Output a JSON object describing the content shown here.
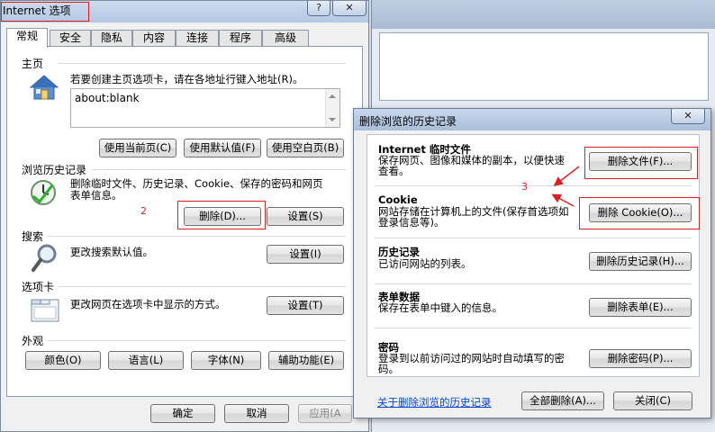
{
  "internet_options": {
    "title": "Internet 选项",
    "tabs": [
      "常规",
      "安全",
      "隐私",
      "内容",
      "连接",
      "程序",
      "高级"
    ],
    "home_page": {
      "section": "主页",
      "description": "若要创建主页选项卡，请在各地址行键入地址(R)。",
      "url_value": "about:blank",
      "use_current_button": "使用当前页(C)",
      "use_default_button": "使用默认值(F)",
      "use_blank_button": "使用空白页(B)"
    },
    "browsing_history": {
      "section": "浏览历史记录",
      "description_line1": "删除临时文件、历史记录、Cookie、保存的密码和网页",
      "description_line2": "表单信息。",
      "delete_button": "删除(D)...",
      "settings_button": "设置(S)"
    },
    "search": {
      "section": "搜索",
      "description": "更改搜索默认值。",
      "settings_button": "设置(I)"
    },
    "tabs_section": {
      "section": "选项卡",
      "description": "更改网页在选项卡中显示的方式。",
      "settings_button": "设置(T)"
    },
    "appearance": {
      "section": "外观",
      "colors_button": "颜色(O)",
      "languages_button": "语言(L)",
      "fonts_button": "字体(N)",
      "accessibility_button": "辅助功能(E)"
    },
    "footer": {
      "ok_button": "确定",
      "cancel_button": "取消",
      "apply_button": "应用(A"
    },
    "titlebar_help": "?",
    "titlebar_close": "✕"
  },
  "delete_history": {
    "title": "删除浏览的历史记录",
    "titlebar_close": "✕",
    "temp_files": {
      "title": "Internet 临时文件",
      "desc_line1": "保存网页、图像和媒体的副本，以便快速",
      "desc_line2": "查看。",
      "button": "删除文件(F)..."
    },
    "cookie": {
      "title": "Cookie",
      "desc_line1": "网站存储在计算机上的文件(保存首选项如",
      "desc_line2": "登录信息等)。",
      "button": "删除 Cookie(O)..."
    },
    "history": {
      "title": "历史记录",
      "desc_line1": "已访问网站的列表。",
      "button": "删除历史记录(H)..."
    },
    "form_data": {
      "title": "表单数据",
      "desc_line1": "保存在表单中键入的信息。",
      "button": "删除表单(E)..."
    },
    "passwords": {
      "title": "密码",
      "desc_line1": "登录到以前访问过的网站时自动填写的密",
      "desc_line2": "码。",
      "button": "删除密码(P)..."
    },
    "about_link": "关于删除浏览的历史记录",
    "delete_all_button": "全部删除(A)...",
    "close_button": "关闭(C)"
  },
  "annotations": {
    "step2": "2",
    "step3": "3",
    "color": "#e02020"
  }
}
